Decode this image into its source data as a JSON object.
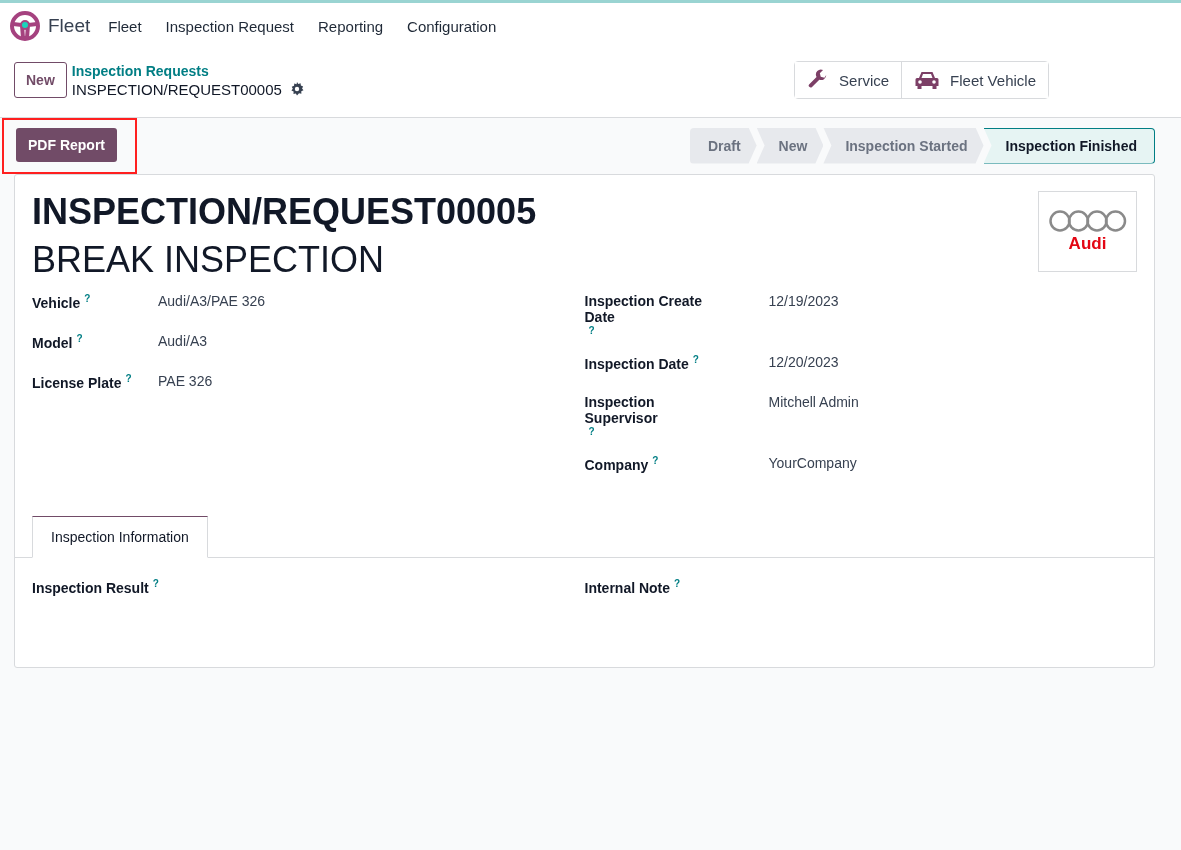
{
  "navbar": {
    "app_name": "Fleet",
    "menu": [
      "Fleet",
      "Inspection Request",
      "Reporting",
      "Configuration"
    ]
  },
  "control_panel": {
    "new_button": "New",
    "breadcrumb": "Inspection Requests",
    "record_name": "INSPECTION/REQUEST00005",
    "smart_buttons": [
      {
        "kind": "wrench",
        "label": "Service"
      },
      {
        "kind": "car",
        "label": "Fleet Vehicle"
      }
    ]
  },
  "actions": {
    "buttons": [
      "PDF Report"
    ],
    "highlighted": true
  },
  "statusbar": [
    {
      "label": "Draft",
      "selected": false
    },
    {
      "label": "New",
      "selected": false
    },
    {
      "label": "Inspection Started",
      "selected": false
    },
    {
      "label": "Inspection Finished",
      "selected": true
    }
  ],
  "form": {
    "title": "INSPECTION/REQUEST00005",
    "subtitle": "BREAK INSPECTION",
    "logo_text": "Audi",
    "left_fields": [
      {
        "label": "Vehicle",
        "help": "?",
        "value": "Audi/A3/PAE 326"
      },
      {
        "label": "Model",
        "help": "?",
        "value": "Audi/A3"
      },
      {
        "label": "License Plate",
        "help": "?",
        "value": "PAE 326"
      }
    ],
    "right_fields": [
      {
        "label": "Inspection Create Date",
        "help": "?",
        "value": "12/19/2023"
      },
      {
        "label": "Inspection Date",
        "help": "?",
        "value": "12/20/2023"
      },
      {
        "label": "Inspection Supervisor",
        "help": "?",
        "value": "Mitchell Admin"
      },
      {
        "label": "Company",
        "help": "?",
        "value": "YourCompany"
      }
    ],
    "tabs": [
      {
        "label": "Inspection Information",
        "selected": true
      }
    ],
    "tab_fields": [
      {
        "label": "Inspection Result",
        "help": "?"
      },
      {
        "label": "Internal Note",
        "help": "?"
      }
    ]
  }
}
